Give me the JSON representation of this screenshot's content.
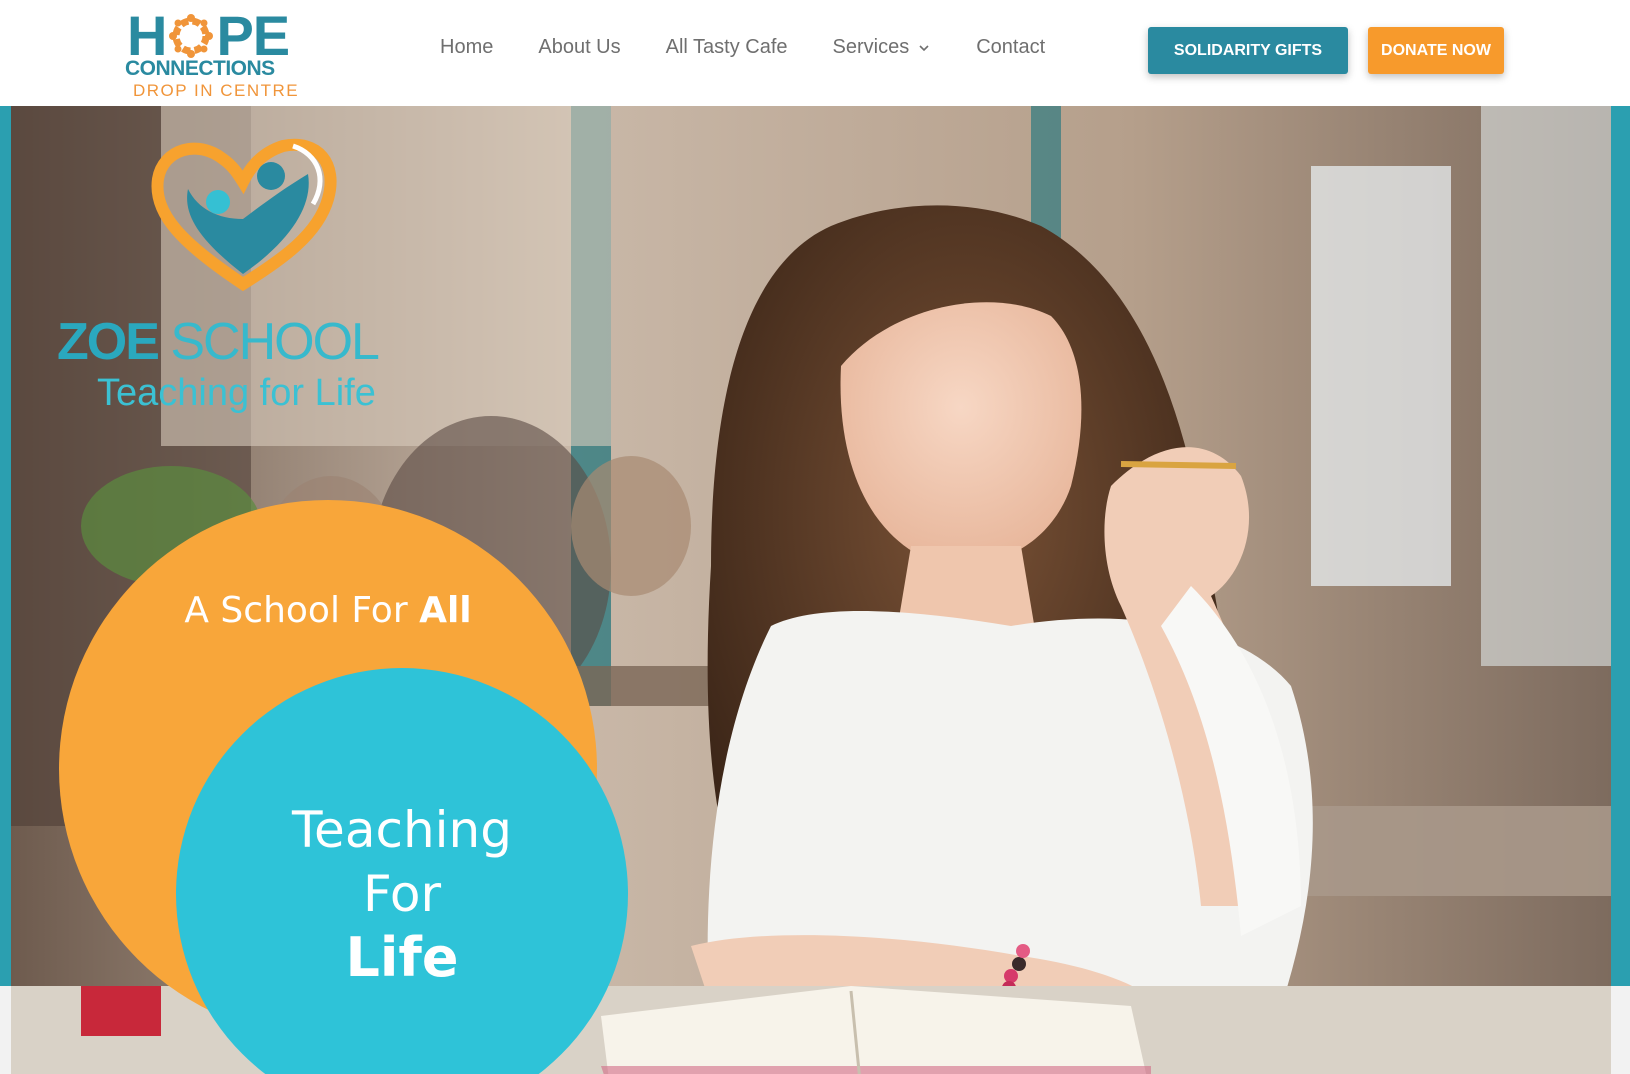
{
  "header": {
    "logo": {
      "word": "HOPE",
      "line2": "CONNECTIONS",
      "line3": "DROP IN CENTRE"
    },
    "nav": [
      {
        "label": "Home"
      },
      {
        "label": "About Us"
      },
      {
        "label": "All Tasty Cafe"
      },
      {
        "label": "Services",
        "has_dropdown": true
      },
      {
        "label": "Contact"
      }
    ],
    "buttons": {
      "gifts": "SOLIDARITY GIFTS",
      "donate": "DONATE NOW"
    }
  },
  "hero": {
    "zoe": {
      "title_bold": "ZOE",
      "title_light": "SCHOOL",
      "subtitle": "Teaching for Life"
    },
    "orange": {
      "text": "A School For ",
      "bold": "All"
    },
    "teal": {
      "line1": "Teaching",
      "line2": "For",
      "line3": "Life"
    }
  },
  "colors": {
    "teal": "#2a8aa0",
    "orange": "#f79a2c",
    "circle_orange": "#f8a63a",
    "circle_teal": "#2ec3d8"
  }
}
